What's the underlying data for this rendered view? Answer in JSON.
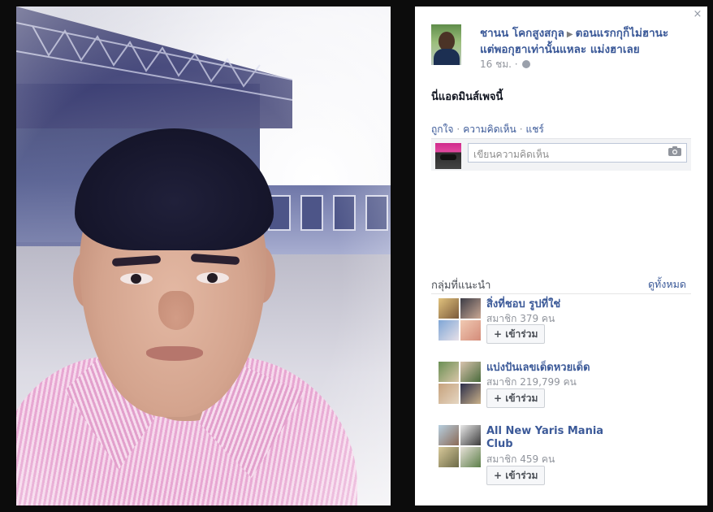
{
  "post": {
    "author": "ชานน โคกสูงสกุล",
    "page": "ตอนแรกกุก็ไม่ฮานะ แต่พอกุฮาเท่านั้นแหละ แม่งฮาเลย",
    "time": "16 ชม.",
    "text": "นี่แอดมินส์เพจนี้"
  },
  "actions": {
    "like": "ถูกใจ",
    "comment": "ความคิดเห็น",
    "share": "แชร์"
  },
  "comment_box": {
    "placeholder": "เขียนความคิดเห็น"
  },
  "groups": {
    "heading": "กลุ่มที่แนะนำ",
    "see_all": "ดูทั้งหมด",
    "join_label": "+ เข้าร่วม",
    "items": [
      {
        "name": "สิ่งที่ชอบ รูปที่ใช่",
        "members": "สมาชิก 379 คน"
      },
      {
        "name": "แบ่งปันเลขเด็ดหวยเด็ด",
        "members": "สมาชิก 219,799 คน"
      },
      {
        "name": "All New Yaris Mania Club",
        "members": "สมาชิก 459 คน"
      }
    ]
  },
  "close_label": "×"
}
